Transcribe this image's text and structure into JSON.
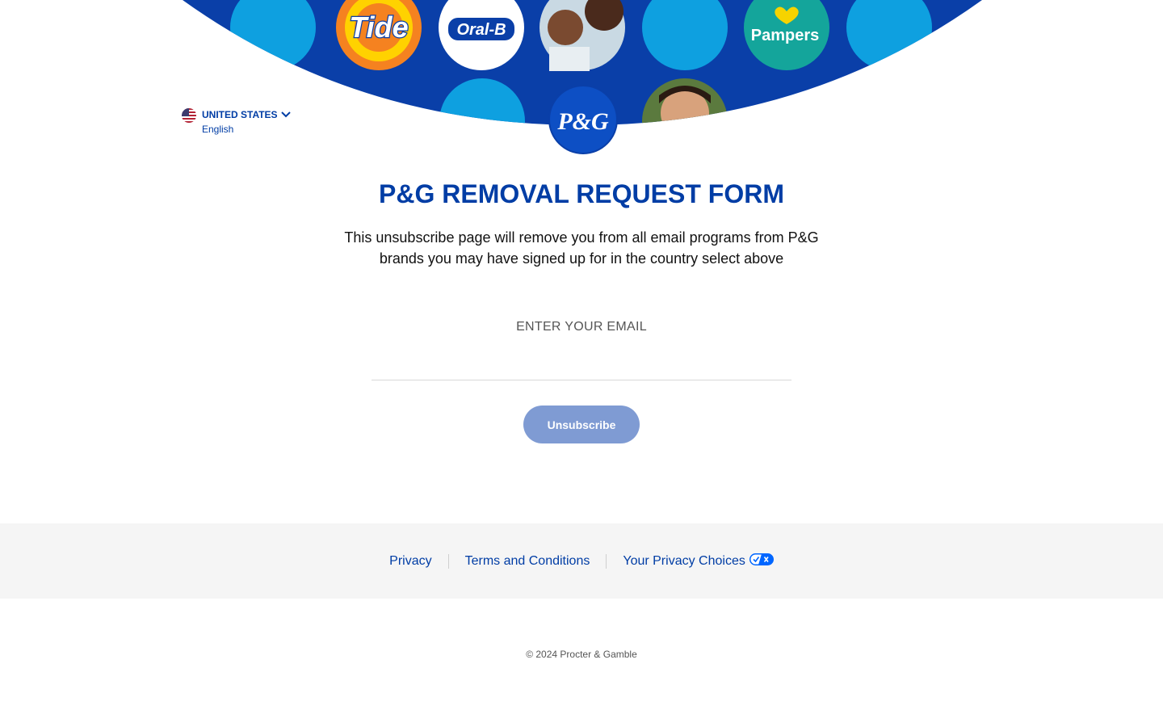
{
  "banner": {
    "brand_logos": [
      "Tide",
      "Oral-B",
      "Pampers",
      "P&G"
    ],
    "colors": {
      "arc_blue": "#0a3fa8",
      "light_blue": "#0ea0e0",
      "teal": "#14a59b"
    }
  },
  "country_selector": {
    "country": "UNITED STATES",
    "language": "English",
    "flag_icon": "us-flag-icon",
    "toggle_icon": "chevron-down-icon"
  },
  "main": {
    "title": "P&G REMOVAL REQUEST FORM",
    "subtitle": "This unsubscribe page will remove you from all email programs from P&G brands you may have signed up for in the country select above",
    "email_label": "ENTER YOUR EMAIL",
    "email_value": "",
    "submit_label": "Unsubscribe"
  },
  "footer": {
    "links": [
      "Privacy",
      "Terms and Conditions",
      "Your Privacy Choices"
    ],
    "privacy_choices_icon": "privacy-options-icon",
    "copyright": "© 2024 Procter & Gamble"
  },
  "colors": {
    "brand_blue": "#003da5",
    "button_bg": "#7f9bd3",
    "footer_bg": "#f5f5f5"
  }
}
